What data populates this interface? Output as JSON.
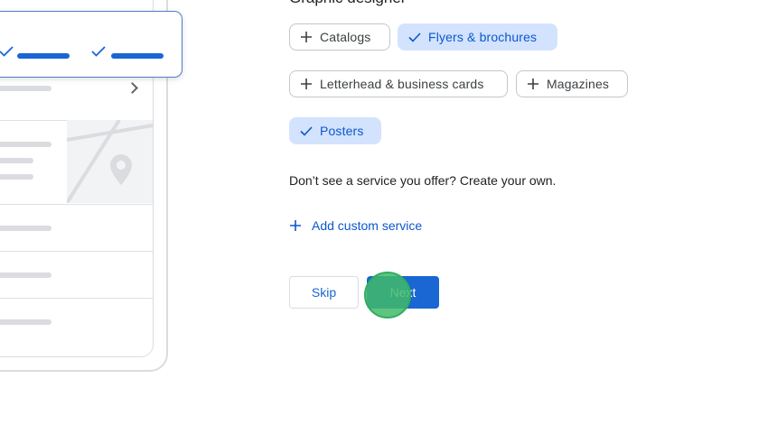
{
  "section": {
    "title": "Graphic designer"
  },
  "chips": [
    {
      "label": "Catalogs",
      "selected": false,
      "icon": "plus-icon"
    },
    {
      "label": "Flyers & brochures",
      "selected": true,
      "icon": "check-icon"
    },
    {
      "label": "Letterhead & business cards",
      "selected": false,
      "icon": "plus-icon"
    },
    {
      "label": "Magazines",
      "selected": false,
      "icon": "plus-icon"
    },
    {
      "label": "Posters",
      "selected": true,
      "icon": "check-icon"
    }
  ],
  "helper_text": "Don’t see a service you offer? Create your own.",
  "add_custom": {
    "label": "Add custom service",
    "icon": "plus-icon"
  },
  "buttons": {
    "skip": "Skip",
    "next": "Next"
  },
  "colors": {
    "accent": "#1a66d2",
    "chip_selected_bg": "#d3e3fd",
    "click_indicator": "#42ba6a"
  }
}
